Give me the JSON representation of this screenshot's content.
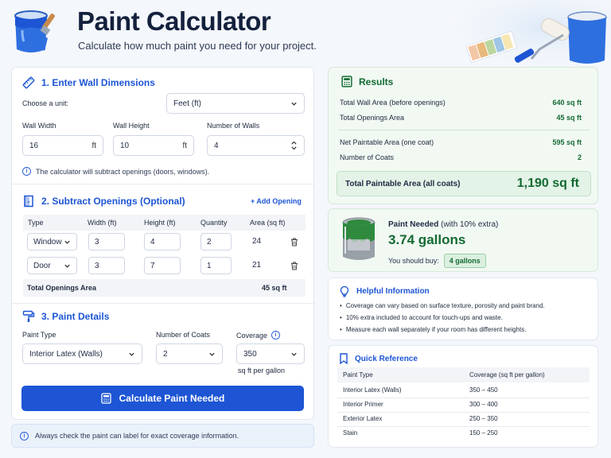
{
  "header": {
    "title": "Paint Calculator",
    "subtitle": "Calculate how much paint you need for your project."
  },
  "dimensions": {
    "title": "1. Enter Wall Dimensions",
    "unit_label": "Choose a unit:",
    "unit_value": "Feet (ft)",
    "width_label": "Wall Width",
    "width_value": "16",
    "width_unit": "ft",
    "height_label": "Wall Height",
    "height_value": "10",
    "height_unit": "ft",
    "walls_label": "Number of Walls",
    "walls_value": "4",
    "note": "The calculator will subtract openings (doors, windows)."
  },
  "openings": {
    "title": "2. Subtract Openings (Optional)",
    "add_label": "+ Add Opening",
    "columns": [
      "Type",
      "Width (ft)",
      "Height (ft)",
      "Quantity",
      "Area (sq ft)"
    ],
    "rows": [
      {
        "type": "Window",
        "width": "3",
        "height": "4",
        "quantity": "2",
        "area": "24"
      },
      {
        "type": "Door",
        "width": "3",
        "height": "7",
        "quantity": "1",
        "area": "21"
      }
    ],
    "total_label": "Total Openings Area",
    "total_value": "45 sq ft"
  },
  "paint": {
    "title": "3. Paint Details",
    "type_label": "Paint Type",
    "type_value": "Interior Latex (Walls)",
    "coats_label": "Number of Coats",
    "coats_value": "2",
    "coverage_label": "Coverage",
    "coverage_value": "350",
    "coverage_unit": "sq ft per gallon",
    "button_label": "Calculate Paint Needed"
  },
  "bottom_note": "Always check the paint can label for exact coverage information.",
  "results": {
    "title": "Results",
    "rows": [
      {
        "label": "Total Wall Area (before openings)",
        "value": "640 sq ft"
      },
      {
        "label": "Total Openings Area",
        "value": "45 sq ft"
      },
      {
        "label": "Net Paintable Area (one coat)",
        "value": "595 sq ft"
      },
      {
        "label": "Number of Coats",
        "value": "2"
      }
    ],
    "total_label": "Total Paintable Area (all coats)",
    "total_value": "1,190 sq ft"
  },
  "paint_needed": {
    "label": "Paint Needed",
    "extra": "(with 10% extra)",
    "value": "3.74 gallons",
    "buy_label": "You should buy:",
    "buy_value": "4 gallons"
  },
  "help": {
    "title": "Helpful Information",
    "items": [
      "Coverage can vary based on surface texture, porosity and paint brand.",
      "10% extra included to account for touch-ups and waste.",
      "Measure each wall separately if your room has different heights."
    ]
  },
  "reference": {
    "title": "Quick Reference",
    "col1": "Paint Type",
    "col2": "Coverage (sq ft per gallon)",
    "rows": [
      {
        "type": "Interior Latex (Walls)",
        "coverage": "350 – 450"
      },
      {
        "type": "Interior Primer",
        "coverage": "300 – 400"
      },
      {
        "type": "Exterior Latex",
        "coverage": "250 – 350"
      },
      {
        "type": "Stain",
        "coverage": "150 – 250"
      }
    ]
  },
  "colors": {
    "accent": "#1d55d4",
    "success": "#136a32"
  }
}
